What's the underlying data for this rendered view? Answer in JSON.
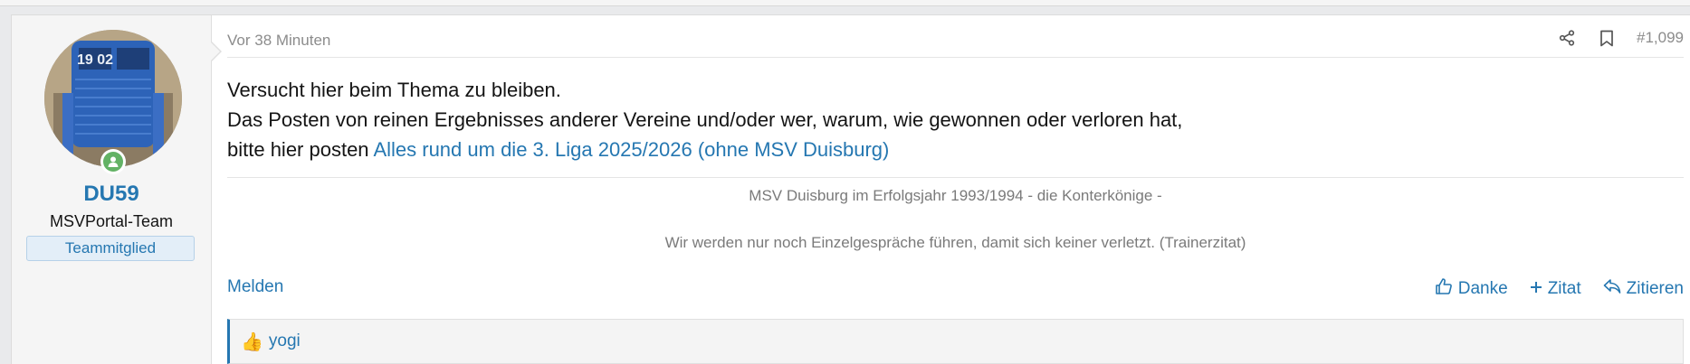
{
  "post": {
    "time": "Vor 38 Minuten",
    "number": "#1,099",
    "body_lines": [
      "Versucht hier beim Thema zu bleiben.",
      "Das Posten von reinen Ergebnisses anderer Vereine und/oder wer, warum, wie gewonnen oder verloren hat,",
      "bitte hier posten "
    ],
    "link_text": "Alles rund um die 3. Liga 2025/2026 (ohne MSV Duisburg)",
    "signature": [
      "MSV Duisburg im Erfolgsjahr 1993/1994 - die Konterkönige -",
      "Wir werden nur noch Einzelgespräche führen, damit sich keiner verletzt. (Trainerzitat)"
    ]
  },
  "user": {
    "name": "DU59",
    "title": "MSVPortal-Team",
    "banner": "Teammitglied",
    "avatar_text": "19 02"
  },
  "actions": {
    "report": "Melden",
    "like": "Danke",
    "quote": "Zitat",
    "reply": "Zitieren"
  },
  "reactions": {
    "users": "yogi"
  },
  "colors": {
    "link": "#2577b1",
    "online": "#63b265",
    "muted": "#8c8c8c"
  },
  "icons": [
    "share-icon",
    "bookmark-icon",
    "thumbs-up-icon",
    "plus-icon",
    "reply-icon",
    "user-online-icon"
  ]
}
